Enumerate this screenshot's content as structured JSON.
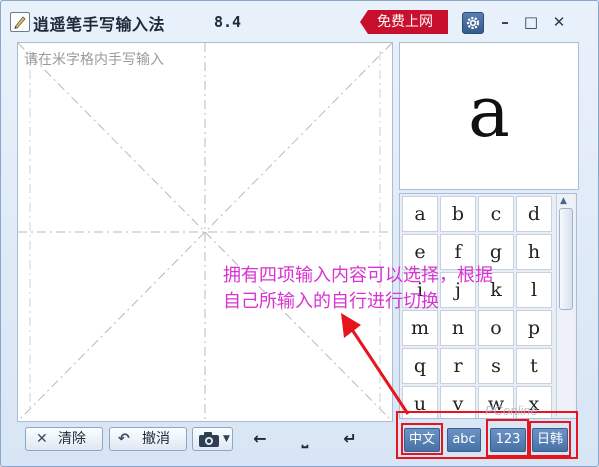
{
  "window": {
    "title": "逍遥笔手写输入法",
    "version": "8.4",
    "promo_label": "免费上网",
    "controls": [
      "–",
      "□",
      "✕"
    ]
  },
  "pad": {
    "hint": "请在米字格内手写输入"
  },
  "preview": {
    "char": "a"
  },
  "candidates": [
    [
      "a",
      "b",
      "c",
      "d"
    ],
    [
      "e",
      "f",
      "g",
      "h"
    ],
    [
      "i",
      "j",
      "k",
      "l"
    ],
    [
      "m",
      "n",
      "o",
      "p"
    ],
    [
      "q",
      "r",
      "s",
      "t"
    ],
    [
      "u",
      "v",
      "w",
      "x"
    ]
  ],
  "toolbar": {
    "clear_label": "清除",
    "undo_label": "撤消",
    "left_arrow": "←",
    "space": "⎵",
    "enter": "↵"
  },
  "modes": {
    "chinese": "中文",
    "abc": "abc",
    "num": "123",
    "japan_korea": "日韩"
  },
  "annotation": {
    "text": "拥有四项输入内容可以选择，根据自己所输入的自行进行切换",
    "line1": "拥有四项输入内容可以选择，根据",
    "line2": "自己所输入的自行进行切换",
    "color": "#d832d0"
  },
  "watermark": "PConline"
}
